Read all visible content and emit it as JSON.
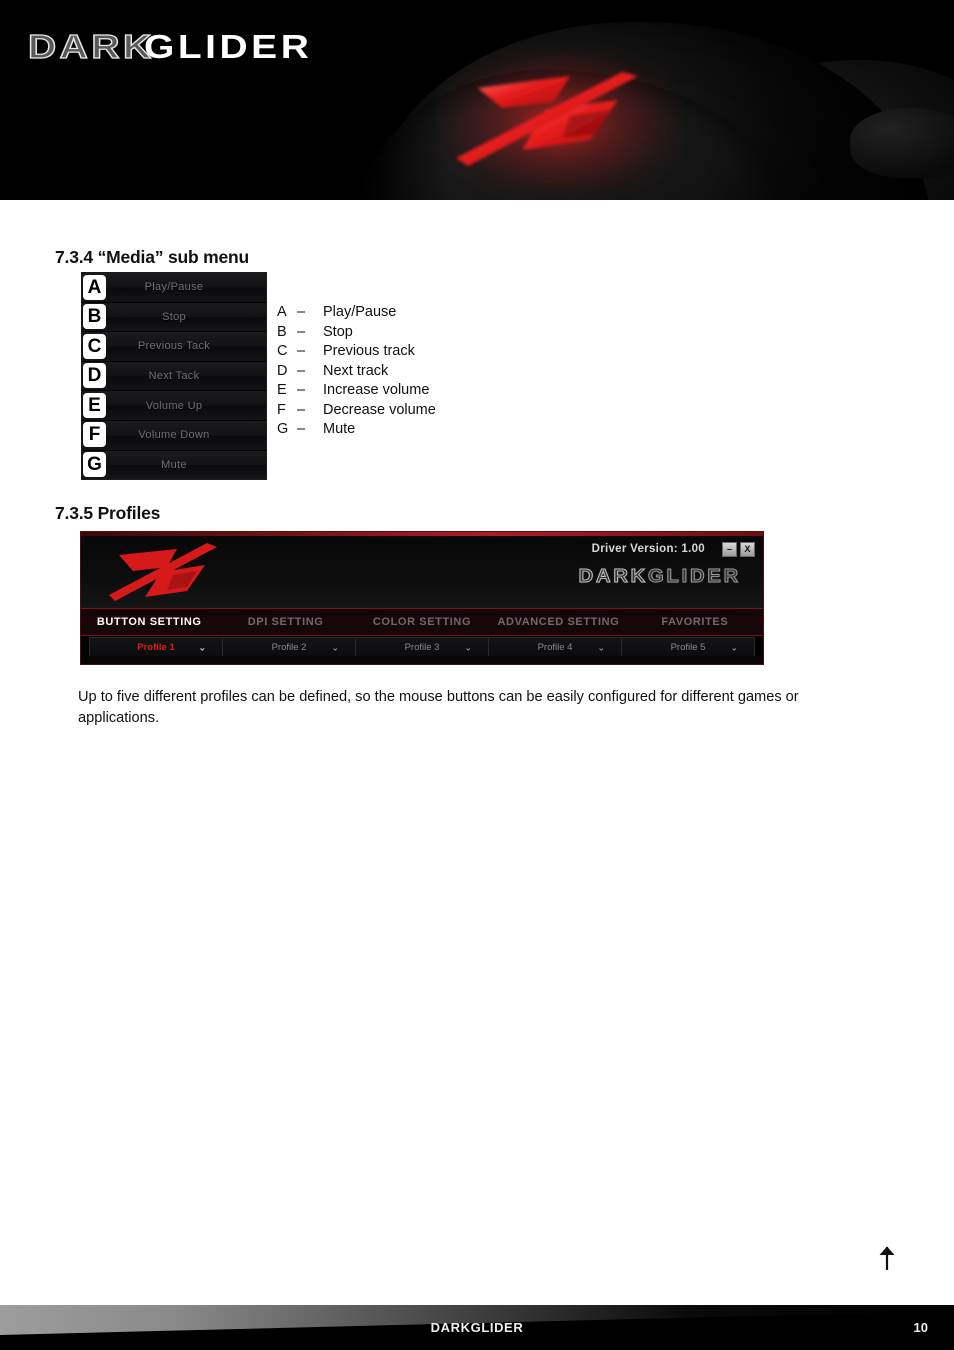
{
  "header": {
    "logo_part1": "DARK",
    "logo_part2": "GLIDER",
    "product_icon": "mouse-with-glowing-z-logo"
  },
  "sections": {
    "media": {
      "heading": "7.3.4 “Media” sub menu",
      "menu_items": [
        {
          "badge": "A",
          "label": "Play/Pause"
        },
        {
          "badge": "B",
          "label": "Stop"
        },
        {
          "badge": "C",
          "label": "Previous Tack"
        },
        {
          "badge": "D",
          "label": "Next Tack"
        },
        {
          "badge": "E",
          "label": "Volume Up"
        },
        {
          "badge": "F",
          "label": "Volume Down"
        },
        {
          "badge": "G",
          "label": "Mute"
        }
      ],
      "legend": [
        {
          "letter": "A",
          "dash": "–",
          "text": "Play/Pause"
        },
        {
          "letter": "B",
          "dash": "–",
          "text": "Stop"
        },
        {
          "letter": "C",
          "dash": "–",
          "text": "Previous track"
        },
        {
          "letter": "D",
          "dash": "–",
          "text": "Next track"
        },
        {
          "letter": "E",
          "dash": "–",
          "text": "Increase volume"
        },
        {
          "letter": "F",
          "dash": "–",
          "text": "Decrease volume"
        },
        {
          "letter": "G",
          "dash": "–",
          "text": "Mute"
        }
      ]
    },
    "profiles": {
      "heading": "7.3.5 Profiles",
      "software_window": {
        "driver_version": "Driver Version: 1.00",
        "brand_part1": "DARK",
        "brand_part2": "GLIDER",
        "window_buttons": [
          {
            "name": "minimize",
            "glyph": "–"
          },
          {
            "name": "close",
            "glyph": "X"
          }
        ],
        "tabs": [
          {
            "label": "BUTTON SETTING",
            "active": true
          },
          {
            "label": "DPI SETTING",
            "active": false
          },
          {
            "label": "COLOR SETTING",
            "active": false
          },
          {
            "label": "ADVANCED SETTING",
            "active": false
          },
          {
            "label": "FAVORITES",
            "active": false
          }
        ],
        "profile_selectors": [
          {
            "label": "Profile 1",
            "active": true,
            "chevron": "⌄"
          },
          {
            "label": "Profile 2",
            "active": false,
            "chevron": "⌄"
          },
          {
            "label": "Profile 3",
            "active": false,
            "chevron": "⌄"
          },
          {
            "label": "Profile 4",
            "active": false,
            "chevron": "⌄"
          },
          {
            "label": "Profile 5",
            "active": false,
            "chevron": "⌄"
          }
        ]
      },
      "paragraph": "Up to five different profiles can be defined, so the mouse buttons can be easily configured for different games or applications."
    }
  },
  "back_to_top": {
    "icon": "up-arrow-icon"
  },
  "footer": {
    "title": "DARKGLIDER",
    "page_number": "10"
  },
  "colors": {
    "accent_red": "#e01b1b",
    "deep_red": "#b01c22",
    "background": "#ffffff",
    "dark": "#000000"
  }
}
